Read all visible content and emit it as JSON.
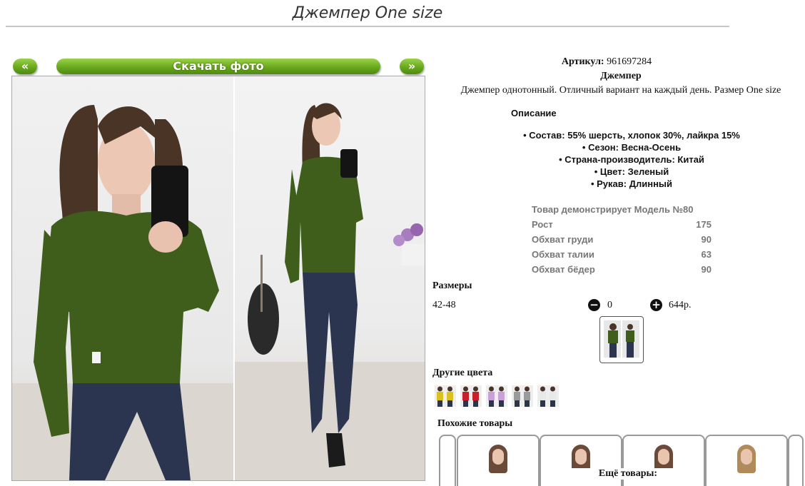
{
  "page": {
    "title": "Джемпер One size"
  },
  "gallery": {
    "prev_label": "«",
    "next_label": "»",
    "download_label": "Скачать фото"
  },
  "product": {
    "article_label": "Артикул:",
    "article_value": "961697284",
    "name": "Джемпер",
    "description": "Джемпер однотонный. Отличный вариант на каждый день. Размер One size"
  },
  "specs": {
    "heading": "Описание",
    "items": [
      "Состав: 55% шерсть, хлопок 30%, лайкра 15%",
      "Сезон: Весна-Осень",
      "Страна-производитель: Китай",
      "Цвет: Зеленый",
      "Рукав: Длинный"
    ]
  },
  "model": {
    "heading": "Товар демонстрирует Модель №80",
    "rows": [
      {
        "label": "Рост",
        "value": "175"
      },
      {
        "label": "Обхват груди",
        "value": "90"
      },
      {
        "label": "Обхват талии",
        "value": "63"
      },
      {
        "label": "Обхват бёдер",
        "value": "90"
      }
    ]
  },
  "sizes": {
    "label": "Размеры",
    "size_name": "42-48",
    "quantity": "0",
    "price": "644р.",
    "minus_icon": "minus-circle-icon",
    "plus_icon": "plus-circle-icon"
  },
  "colors": {
    "label": "Другие цвета",
    "swatches": [
      "#d9c21e",
      "#c8202a",
      "#c9a0d8",
      "#9a9a9a",
      "#e8e8e8"
    ]
  },
  "similar": {
    "label": "Похожие товары"
  },
  "more": {
    "label": "Ещё товары:"
  },
  "theme": {
    "accent": "#6aa81e",
    "sweater": "#3f5e1c",
    "jeans": "#2b3550"
  }
}
